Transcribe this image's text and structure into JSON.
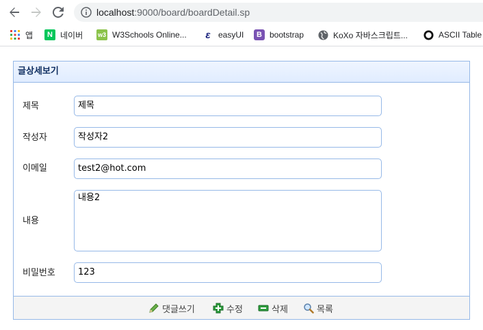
{
  "browser": {
    "url_host": "localhost",
    "url_path": ":9000/board/boardDetail.sp",
    "bookmarks": [
      {
        "label": "앱",
        "icon": "apps-grid-icon"
      },
      {
        "label": "네이버",
        "icon": "naver-icon",
        "badge": "N",
        "color": "#03c75a"
      },
      {
        "label": "W3Schools Online...",
        "icon": "w3schools-icon",
        "badge": "w3",
        "color": "#8bc34a"
      },
      {
        "label": "easyUI",
        "icon": "easyui-icon",
        "badge": "ε",
        "color": "#1a237e"
      },
      {
        "label": "bootstrap",
        "icon": "bootstrap-icon",
        "badge": "B",
        "color": "#7952b3"
      },
      {
        "label": "KoXo 자바스크립트...",
        "icon": "globe-icon"
      },
      {
        "label": "ASCII Table",
        "icon": "ascii-icon"
      }
    ]
  },
  "panel": {
    "title": "글상세보기",
    "fields": {
      "title_label": "제목",
      "title_value": "제목",
      "writer_label": "작성자",
      "writer_value": "작성자2",
      "email_label": "이메일",
      "email_value": "test2@hot.com",
      "content_label": "내용",
      "content_value": "내용2",
      "password_label": "비밀번호",
      "password_value": "123"
    },
    "buttons": {
      "reply": "댓글쓰기",
      "edit": "수정",
      "delete": "삭제",
      "list": "목록"
    }
  }
}
